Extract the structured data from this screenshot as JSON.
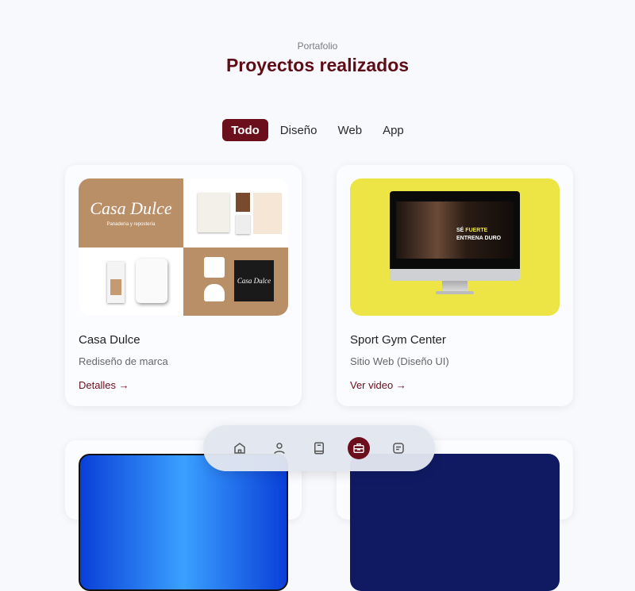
{
  "header": {
    "subtitle": "Portafolio",
    "title": "Proyectos realizados"
  },
  "tabs": [
    {
      "label": "Todo",
      "active": true
    },
    {
      "label": "Diseño"
    },
    {
      "label": "Web"
    },
    {
      "label": "App"
    }
  ],
  "projects": [
    {
      "title": "Casa Dulce",
      "subtitle": "Rediseño de marca",
      "link": "Detalles →",
      "image_text": "Casa Dulce",
      "image_tagline": "Panadería y repostería"
    },
    {
      "title": "Sport Gym Center",
      "subtitle": "Sitio Web (Diseño UI)",
      "link": "Ver video →",
      "image_line1": "SÉ",
      "image_highlight": "FUERTE",
      "image_line2": "ENTRENA DURO"
    }
  ],
  "nav": {
    "items": [
      "home-icon",
      "user-icon",
      "book-icon",
      "briefcase-icon",
      "message-icon"
    ],
    "active": "briefcase-icon"
  },
  "colors": {
    "accent": "#6b0f1c",
    "gym_bg": "#ede445",
    "brand_tan": "#b98f68"
  }
}
